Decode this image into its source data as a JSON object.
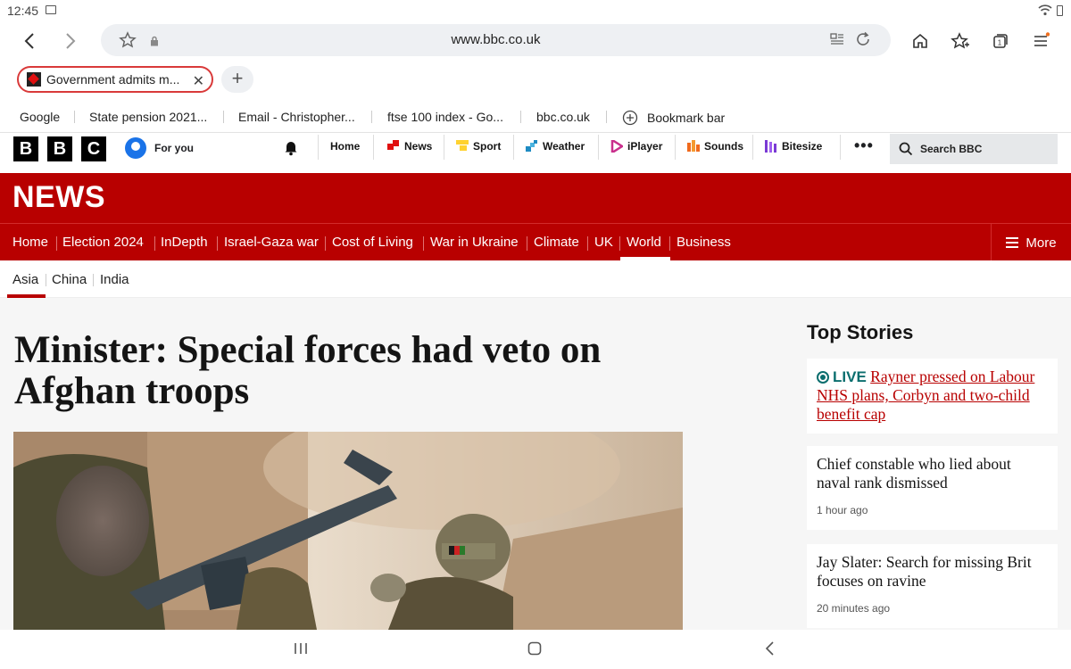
{
  "status_bar": {
    "time": "12:45"
  },
  "browser": {
    "url": "www.bbc.co.uk",
    "tab": {
      "title": "Government admits m..."
    },
    "bookmarks": [
      "Google",
      "State pension 2021...",
      "Email - Christopher...",
      "ftse 100 index - Go...",
      "bbc.co.uk"
    ],
    "bookmark_bar_label": "Bookmark bar"
  },
  "bbc_masthead": {
    "logo_letters": [
      "B",
      "B",
      "C"
    ],
    "for_you": "For you",
    "links": [
      "Home",
      "News",
      "Sport",
      "Weather",
      "iPlayer",
      "Sounds",
      "Bitesize"
    ],
    "more_dots": "•••",
    "search_label": "Search BBC"
  },
  "news": {
    "logo": "NEWS",
    "sections": [
      "Home",
      "Election 2024",
      "InDepth",
      "Israel-Gaza war",
      "Cost of Living",
      "War in Ukraine",
      "Climate",
      "UK",
      "World",
      "Business"
    ],
    "active_section": "World",
    "more_label": "More",
    "subsections": [
      "Asia",
      "China",
      "India"
    ],
    "active_subsection": "Asia"
  },
  "article": {
    "headline": "Minister: Special forces had veto on Afghan troops"
  },
  "top_stories": {
    "heading": "Top Stories",
    "items": [
      {
        "live": "LIVE",
        "title": "Rayner pressed on Labour NHS plans, Corbyn and two-child benefit cap"
      },
      {
        "title": "Chief constable who lied about naval rank dismissed",
        "time": "1 hour ago"
      },
      {
        "title": "Jay Slater: Search for missing Brit focuses on ravine",
        "time": "20 minutes ago"
      }
    ]
  },
  "colors": {
    "bbc_red": "#b80000",
    "live_teal": "#0b6e6e",
    "tab_border": "#d93a3a"
  }
}
